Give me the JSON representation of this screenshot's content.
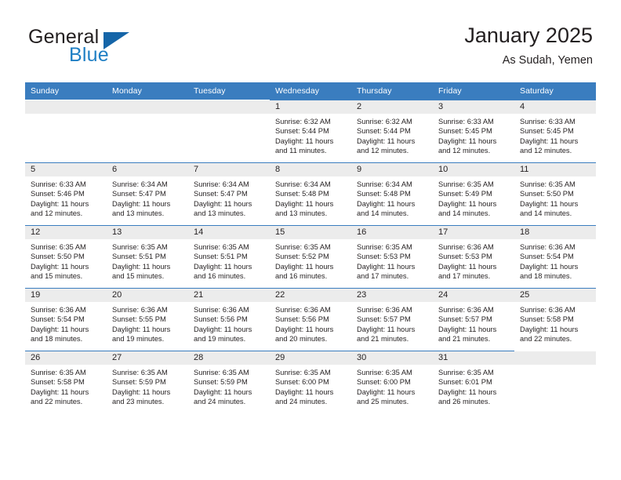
{
  "brand": {
    "name_part1": "General",
    "name_part2": "Blue",
    "logo_icon": "triangle-logo-icon",
    "accent_color": "#1f7fc4"
  },
  "header": {
    "title": "January 2025",
    "subtitle": "As Sudah, Yemen"
  },
  "colors": {
    "header_blue": "#3a7dbf",
    "daynum_band": "#ececec",
    "text": "#231f20"
  },
  "weekdays": [
    "Sunday",
    "Monday",
    "Tuesday",
    "Wednesday",
    "Thursday",
    "Friday",
    "Saturday"
  ],
  "weeks": [
    [
      {
        "day": "",
        "empty": true
      },
      {
        "day": "",
        "empty": true
      },
      {
        "day": "",
        "empty": true
      },
      {
        "day": "1",
        "sunrise": "Sunrise: 6:32 AM",
        "sunset": "Sunset: 5:44 PM",
        "daylight": "Daylight: 11 hours and 11 minutes."
      },
      {
        "day": "2",
        "sunrise": "Sunrise: 6:32 AM",
        "sunset": "Sunset: 5:44 PM",
        "daylight": "Daylight: 11 hours and 12 minutes."
      },
      {
        "day": "3",
        "sunrise": "Sunrise: 6:33 AM",
        "sunset": "Sunset: 5:45 PM",
        "daylight": "Daylight: 11 hours and 12 minutes."
      },
      {
        "day": "4",
        "sunrise": "Sunrise: 6:33 AM",
        "sunset": "Sunset: 5:45 PM",
        "daylight": "Daylight: 11 hours and 12 minutes."
      }
    ],
    [
      {
        "day": "5",
        "sunrise": "Sunrise: 6:33 AM",
        "sunset": "Sunset: 5:46 PM",
        "daylight": "Daylight: 11 hours and 12 minutes."
      },
      {
        "day": "6",
        "sunrise": "Sunrise: 6:34 AM",
        "sunset": "Sunset: 5:47 PM",
        "daylight": "Daylight: 11 hours and 13 minutes."
      },
      {
        "day": "7",
        "sunrise": "Sunrise: 6:34 AM",
        "sunset": "Sunset: 5:47 PM",
        "daylight": "Daylight: 11 hours and 13 minutes."
      },
      {
        "day": "8",
        "sunrise": "Sunrise: 6:34 AM",
        "sunset": "Sunset: 5:48 PM",
        "daylight": "Daylight: 11 hours and 13 minutes."
      },
      {
        "day": "9",
        "sunrise": "Sunrise: 6:34 AM",
        "sunset": "Sunset: 5:48 PM",
        "daylight": "Daylight: 11 hours and 14 minutes."
      },
      {
        "day": "10",
        "sunrise": "Sunrise: 6:35 AM",
        "sunset": "Sunset: 5:49 PM",
        "daylight": "Daylight: 11 hours and 14 minutes."
      },
      {
        "day": "11",
        "sunrise": "Sunrise: 6:35 AM",
        "sunset": "Sunset: 5:50 PM",
        "daylight": "Daylight: 11 hours and 14 minutes."
      }
    ],
    [
      {
        "day": "12",
        "sunrise": "Sunrise: 6:35 AM",
        "sunset": "Sunset: 5:50 PM",
        "daylight": "Daylight: 11 hours and 15 minutes."
      },
      {
        "day": "13",
        "sunrise": "Sunrise: 6:35 AM",
        "sunset": "Sunset: 5:51 PM",
        "daylight": "Daylight: 11 hours and 15 minutes."
      },
      {
        "day": "14",
        "sunrise": "Sunrise: 6:35 AM",
        "sunset": "Sunset: 5:51 PM",
        "daylight": "Daylight: 11 hours and 16 minutes."
      },
      {
        "day": "15",
        "sunrise": "Sunrise: 6:35 AM",
        "sunset": "Sunset: 5:52 PM",
        "daylight": "Daylight: 11 hours and 16 minutes."
      },
      {
        "day": "16",
        "sunrise": "Sunrise: 6:35 AM",
        "sunset": "Sunset: 5:53 PM",
        "daylight": "Daylight: 11 hours and 17 minutes."
      },
      {
        "day": "17",
        "sunrise": "Sunrise: 6:36 AM",
        "sunset": "Sunset: 5:53 PM",
        "daylight": "Daylight: 11 hours and 17 minutes."
      },
      {
        "day": "18",
        "sunrise": "Sunrise: 6:36 AM",
        "sunset": "Sunset: 5:54 PM",
        "daylight": "Daylight: 11 hours and 18 minutes."
      }
    ],
    [
      {
        "day": "19",
        "sunrise": "Sunrise: 6:36 AM",
        "sunset": "Sunset: 5:54 PM",
        "daylight": "Daylight: 11 hours and 18 minutes."
      },
      {
        "day": "20",
        "sunrise": "Sunrise: 6:36 AM",
        "sunset": "Sunset: 5:55 PM",
        "daylight": "Daylight: 11 hours and 19 minutes."
      },
      {
        "day": "21",
        "sunrise": "Sunrise: 6:36 AM",
        "sunset": "Sunset: 5:56 PM",
        "daylight": "Daylight: 11 hours and 19 minutes."
      },
      {
        "day": "22",
        "sunrise": "Sunrise: 6:36 AM",
        "sunset": "Sunset: 5:56 PM",
        "daylight": "Daylight: 11 hours and 20 minutes."
      },
      {
        "day": "23",
        "sunrise": "Sunrise: 6:36 AM",
        "sunset": "Sunset: 5:57 PM",
        "daylight": "Daylight: 11 hours and 21 minutes."
      },
      {
        "day": "24",
        "sunrise": "Sunrise: 6:36 AM",
        "sunset": "Sunset: 5:57 PM",
        "daylight": "Daylight: 11 hours and 21 minutes."
      },
      {
        "day": "25",
        "sunrise": "Sunrise: 6:36 AM",
        "sunset": "Sunset: 5:58 PM",
        "daylight": "Daylight: 11 hours and 22 minutes."
      }
    ],
    [
      {
        "day": "26",
        "sunrise": "Sunrise: 6:35 AM",
        "sunset": "Sunset: 5:58 PM",
        "daylight": "Daylight: 11 hours and 22 minutes."
      },
      {
        "day": "27",
        "sunrise": "Sunrise: 6:35 AM",
        "sunset": "Sunset: 5:59 PM",
        "daylight": "Daylight: 11 hours and 23 minutes."
      },
      {
        "day": "28",
        "sunrise": "Sunrise: 6:35 AM",
        "sunset": "Sunset: 5:59 PM",
        "daylight": "Daylight: 11 hours and 24 minutes."
      },
      {
        "day": "29",
        "sunrise": "Sunrise: 6:35 AM",
        "sunset": "Sunset: 6:00 PM",
        "daylight": "Daylight: 11 hours and 24 minutes."
      },
      {
        "day": "30",
        "sunrise": "Sunrise: 6:35 AM",
        "sunset": "Sunset: 6:00 PM",
        "daylight": "Daylight: 11 hours and 25 minutes."
      },
      {
        "day": "31",
        "sunrise": "Sunrise: 6:35 AM",
        "sunset": "Sunset: 6:01 PM",
        "daylight": "Daylight: 11 hours and 26 minutes."
      },
      {
        "day": "",
        "empty": true
      }
    ]
  ]
}
